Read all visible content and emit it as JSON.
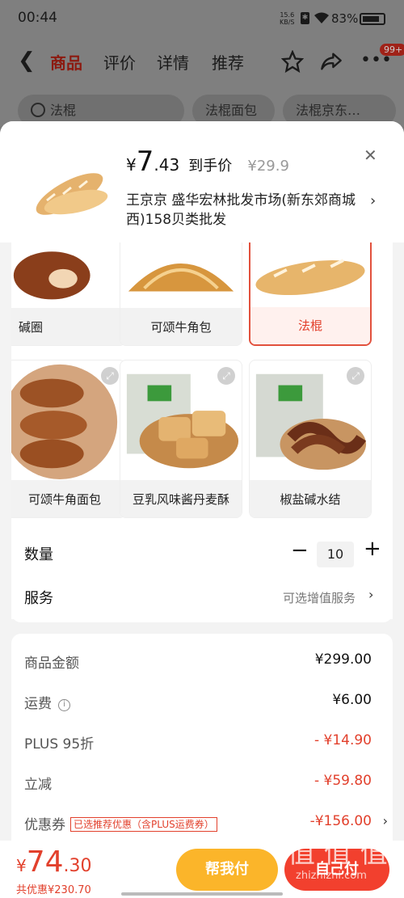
{
  "status": {
    "time": "00:44",
    "net_speed": "15.6",
    "net_unit": "KB/S",
    "battery": "83%"
  },
  "nav": {
    "tabs": [
      "商品",
      "评价",
      "详情",
      "推荐"
    ],
    "active_tab": 0,
    "badge": "99+"
  },
  "search": {
    "pills": [
      "法棍",
      "法棍面包",
      "法棍京东…"
    ]
  },
  "product": {
    "yen": "¥",
    "price_int": "7",
    "price_dec": ".43",
    "price_label": "到手价",
    "original_price": "¥29.9",
    "shop": "王京京  盛华宏林批发市场(新东郊商城西)158贝类批发"
  },
  "variants": [
    {
      "label": "碱圈",
      "selected": false
    },
    {
      "label": "可颂牛角包",
      "selected": false
    },
    {
      "label": "法棍",
      "selected": true
    },
    {
      "label": "可颂牛角面包",
      "selected": false
    },
    {
      "label": "豆乳风味酱丹麦酥",
      "selected": false
    },
    {
      "label": "椒盐碱水结",
      "selected": false
    }
  ],
  "quantity": {
    "label": "数量",
    "value": "10",
    "minus": "−",
    "plus": "+"
  },
  "service": {
    "label": "服务",
    "value": "可选增值服务"
  },
  "summary": {
    "rows": [
      {
        "k": "商品金额",
        "v": "¥299.00"
      },
      {
        "k": "运费",
        "v": "¥6.00"
      },
      {
        "k": "PLUS 95折",
        "v": "- ¥14.90"
      },
      {
        "k": "立减",
        "v": "- ¥59.80"
      },
      {
        "k": "优惠券",
        "tag": "已选推荐优惠（含PLUS运费券）",
        "v": "-¥156.00"
      }
    ]
  },
  "bottom": {
    "yen": "¥",
    "total_int": "74",
    "total_dec": ".30",
    "saved": "共优惠¥230.70",
    "help_pay": "帮我付",
    "self_pay": "自己付"
  },
  "watermark": {
    "line1": "值 值 值",
    "line2": "zhizhizhi.com"
  },
  "colors": {
    "accent": "#e2402c",
    "help_button": "#fbb52a",
    "pay_button": "#f2402e"
  }
}
